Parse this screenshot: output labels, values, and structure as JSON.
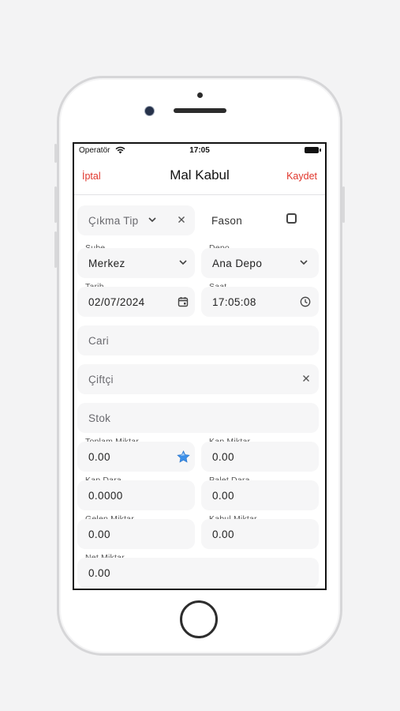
{
  "status_bar": {
    "carrier": "Operatör",
    "time": "17:05"
  },
  "navbar": {
    "left": "İptal",
    "title": "Mal Kabul",
    "right": "Kaydet"
  },
  "form": {
    "cikma_tip": {
      "placeholder": "Çıkma Tip"
    },
    "fason": {
      "label": "Fason",
      "checked": false
    },
    "sube": {
      "label": "Şube",
      "value": "Merkez"
    },
    "depo": {
      "label": "Depo",
      "value": "Ana Depo"
    },
    "tarih": {
      "label": "Tarih",
      "value": "02/07/2024"
    },
    "saat": {
      "label": "Saat",
      "value": "17:05:08"
    },
    "cari": {
      "placeholder": "Cari"
    },
    "ciftci": {
      "placeholder": "Çiftçi"
    },
    "stok": {
      "placeholder": "Stok"
    },
    "toplam_miktar": {
      "label": "Toplam Miktar",
      "value": "0.00"
    },
    "kap_miktar": {
      "label": "Kap Miktar",
      "value": "0.00"
    },
    "kap_dara": {
      "label": "Kap Dara",
      "value": "0.0000"
    },
    "palet_dara": {
      "label": "Palet Dara",
      "value": "0.00"
    },
    "gelen_miktar": {
      "label": "Gelen Miktar",
      "value": "0.00"
    },
    "kabul_miktar": {
      "label": "Kabul Miktar",
      "value": "0.00"
    },
    "net_miktar": {
      "label": "Net Miktar",
      "value": "0.00"
    }
  },
  "colors": {
    "accent": "#e0352b",
    "field_bg": "#f6f6f7",
    "star": "#3b8fe8"
  },
  "icons": {
    "cikma_tip": [
      "chevron-down-icon",
      "close-icon"
    ],
    "sube": "chevron-down-icon",
    "depo": "chevron-down-icon",
    "tarih": "calendar-icon",
    "saat": "clock-icon",
    "ciftci": "close-icon",
    "toplam_miktar": "star-icon"
  }
}
